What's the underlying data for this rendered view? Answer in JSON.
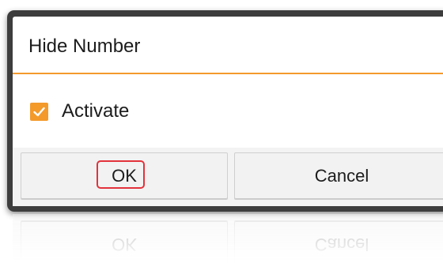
{
  "dialog": {
    "title": "Hide Number",
    "checkbox": {
      "label": "Activate",
      "checked": true
    },
    "buttons": {
      "ok_label": "OK",
      "cancel_label": "Cancel"
    }
  },
  "colors": {
    "accent": "#f39a2b",
    "highlight": "#e3323b",
    "frame": "#3d3d3d"
  },
  "icons": {
    "check": "checkmark-icon"
  }
}
